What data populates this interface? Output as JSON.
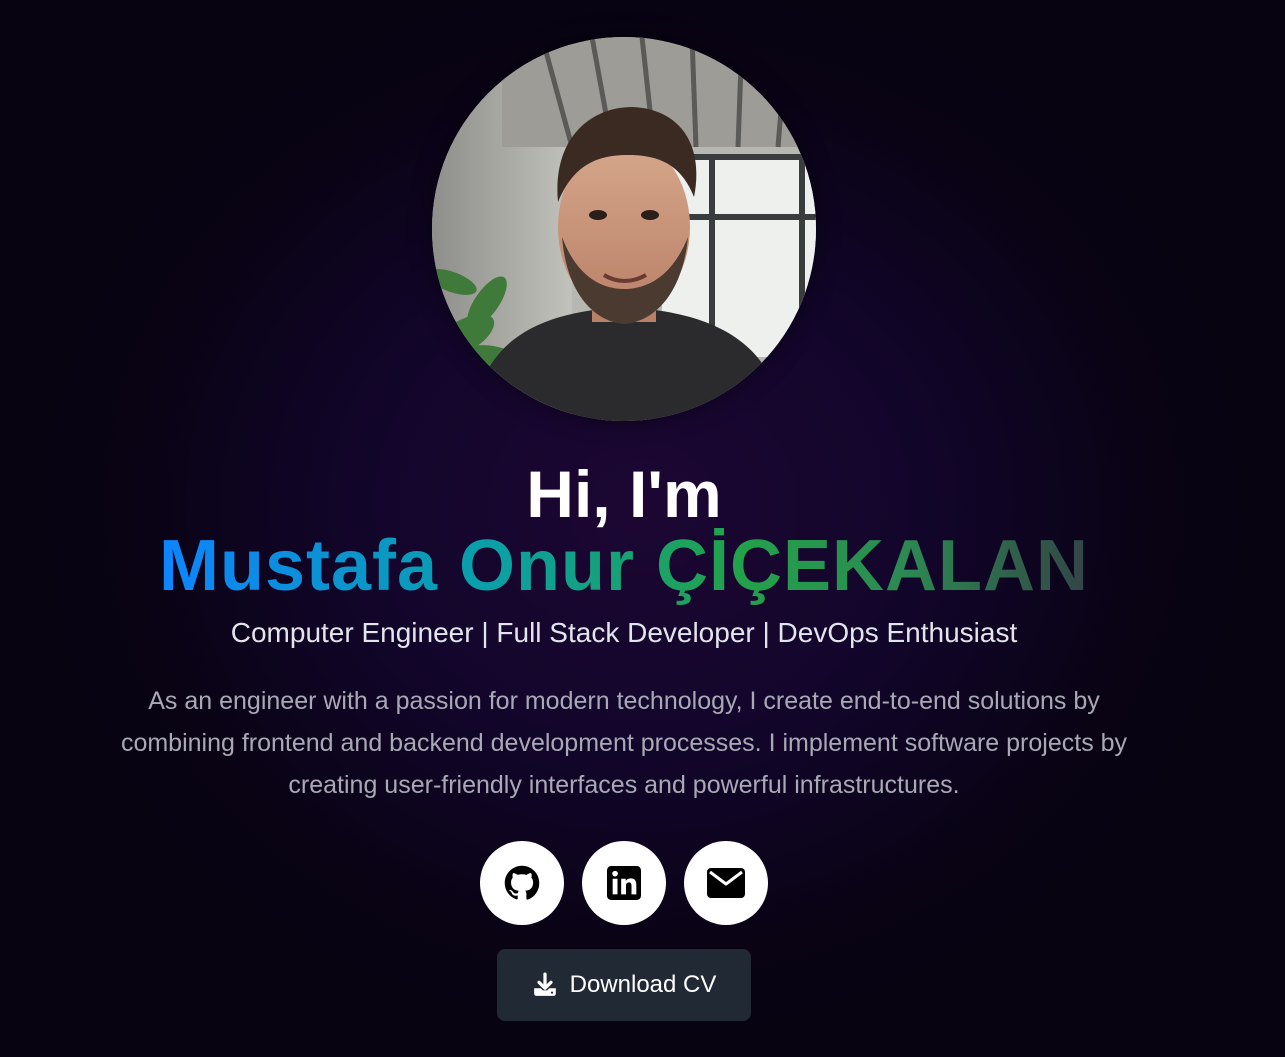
{
  "hero": {
    "greeting": "Hi, I'm",
    "name": "Mustafa Onur ÇİÇEKALAN",
    "subtitle": "Computer Engineer | Full Stack Developer | DevOps Enthusiast",
    "bio": "As an engineer with a passion for modern technology, I create end-to-end solutions by combining frontend and backend development processes. I implement software projects by creating user-friendly interfaces and powerful infrastructures."
  },
  "social": [
    {
      "icon": "github-icon"
    },
    {
      "icon": "linkedin-icon"
    },
    {
      "icon": "envelope-icon"
    }
  ],
  "cv_button": {
    "label": "Download CV",
    "icon": "download-icon"
  },
  "colors": {
    "background": "#12052a",
    "name_gradient_start": "#0d84ff",
    "name_gradient_mid": "#22a24a",
    "name_gradient_end": "#334446",
    "button_bg": "#212934"
  }
}
